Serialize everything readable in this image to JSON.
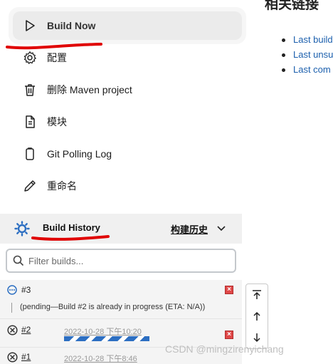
{
  "tasks": [
    {
      "label": "Build Now",
      "icon": "play-icon"
    },
    {
      "label": "配置",
      "icon": "gear-icon"
    },
    {
      "label": "删除 Maven project",
      "icon": "trash-icon"
    },
    {
      "label": "模块",
      "icon": "document-icon"
    },
    {
      "label": "Git Polling Log",
      "icon": "clipboard-icon"
    },
    {
      "label": "重命名",
      "icon": "pencil-icon"
    }
  ],
  "right_panel": {
    "title": "相关链接",
    "links": [
      "Last build",
      "Last unsu",
      "Last com"
    ]
  },
  "build_history": {
    "title": "Build History",
    "trend": "构建历史",
    "filter_placeholder": "Filter builds...",
    "builds": [
      {
        "number": "#3",
        "status": "pending",
        "message": "(pending—Build #2 is already in progress (ETA: N/A))"
      },
      {
        "number": "#2",
        "status": "aborted",
        "date": "2022-10-28 下午10:20",
        "in_progress": true
      },
      {
        "number": "#1",
        "status": "aborted",
        "date": "2022-10-28 下午8:46"
      }
    ]
  },
  "watermark": "CSDN @mingzirenyichang",
  "colors": {
    "link": "#1b5fad",
    "annotation": "#e00000",
    "progress": "#2d6fc2",
    "cancel": "#e04848"
  }
}
